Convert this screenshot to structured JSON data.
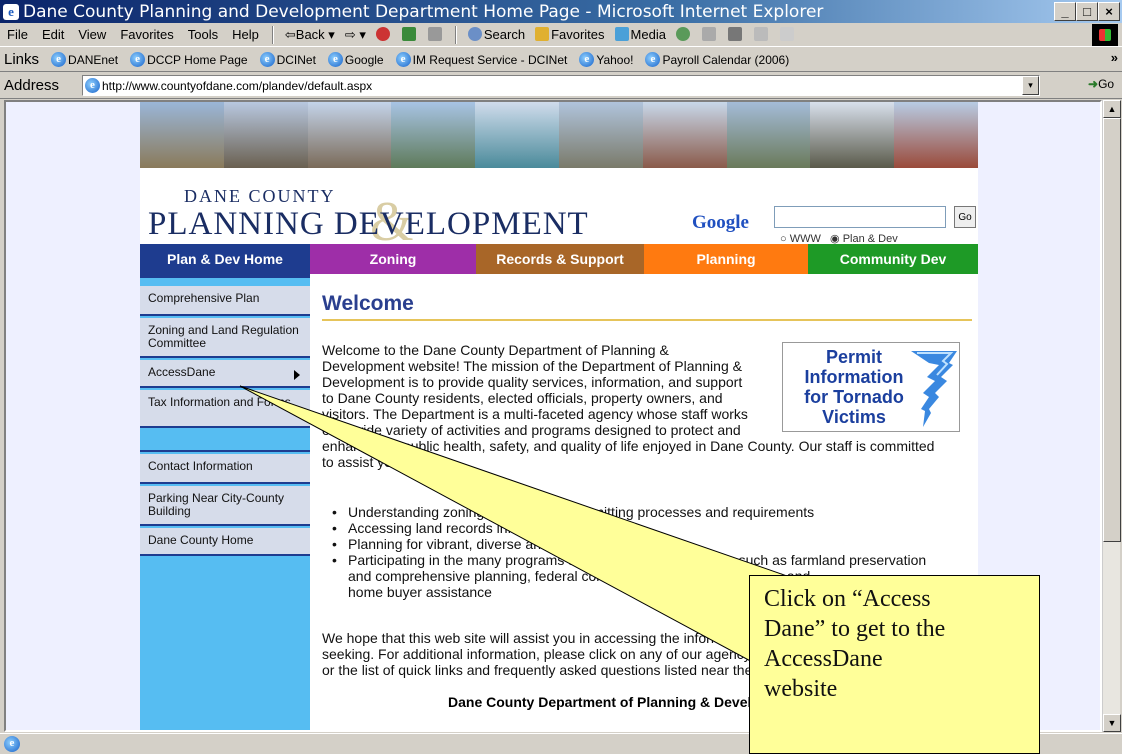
{
  "window": {
    "title": "Dane County Planning and Development Department Home Page - Microsoft Internet Explorer",
    "min_glyph": "_",
    "max_glyph": "□",
    "close_glyph": "×"
  },
  "menu": {
    "items": [
      "File",
      "Edit",
      "View",
      "Favorites",
      "Tools",
      "Help"
    ],
    "back": "⇦Back ▾",
    "forward": "⇨ ▾",
    "search": "Search",
    "favorites": "Favorites",
    "media": "Media"
  },
  "links_bar": {
    "label": "Links",
    "items": [
      "DANEnet",
      "DCCP Home Page",
      "DCINet",
      "Google",
      "IM Request Service - DCINet",
      "Yahoo!",
      "Payroll Calendar (2006)"
    ],
    "more": "»"
  },
  "address_bar": {
    "label": "Address",
    "url": "http://www.countyofdane.com/plandev/default.aspx",
    "go": "Go",
    "dropdown_glyph": "▾"
  },
  "site": {
    "logo_small": "Dane County",
    "logo_big": "PLANNING DEVELOPMENT",
    "logo_amp": "&",
    "google": {
      "logo": "Google",
      "go": "Go",
      "radio_www": "WWW",
      "radio_plandev": "Plan & Dev"
    },
    "nav": [
      {
        "label": "Plan & Dev Home",
        "color": "#1e3c8f"
      },
      {
        "label": "Zoning",
        "color": "#9e2ea8"
      },
      {
        "label": "Records & Support",
        "color": "#a86628"
      },
      {
        "label": "Planning",
        "color": "#ff7a10"
      },
      {
        "label": "Community Dev",
        "color": "#1e9a26"
      }
    ],
    "sidebar": [
      "Comprehensive Plan",
      "Zoning and Land Regulation Committee",
      "AccessDane",
      "Tax Information and Forms",
      "Contact Information",
      "Parking Near City-County Building",
      "Dane County Home"
    ],
    "welcome_title": "Welcome",
    "intro_lines": [
      "Welcome to the Dane County Department of Planning &",
      "Development website! The mission of the Department of Planning &",
      "Development is to provide quality services, information, and support",
      "to Dane County residents, elected officials, property owners, and",
      "visitors. The Department is a multi-faceted agency whose staff works",
      "on a wide variety of activities and programs designed to protect and",
      "enhance the public health, safety, and quality of life enjoyed in Dane County. Our staff is committed",
      "to assist you in:"
    ],
    "permit_lines": [
      "Permit",
      "Information",
      "for Tornado",
      "Victims"
    ],
    "bullets": [
      "Understanding zoning and land use permitting processes and requirements",
      "Accessing land records information and maps",
      "Planning for vibrant, diverse and efficient communities",
      "Participating in the many programs and projects we administer such as farmland preservation",
      "and comprehensive planning, federal community development funding and",
      "home buyer assistance"
    ],
    "closing_lines": [
      "We hope that this web site will assist you in accessing the information you are",
      "seeking. For additional information, please click on any of our agency departments above,",
      "or the list of quick links and frequently asked questions listed near the bottom."
    ],
    "signature": "Dane County Department of Planning & Development"
  },
  "callout": {
    "lines": [
      "Click on “Access",
      "Dane” to get to the",
      "AccessDane",
      "website"
    ]
  },
  "colors": {
    "nav_blue": "#1e3c8f",
    "sidebar_bg": "#56bdf2",
    "callout_bg": "#ffff99"
  }
}
